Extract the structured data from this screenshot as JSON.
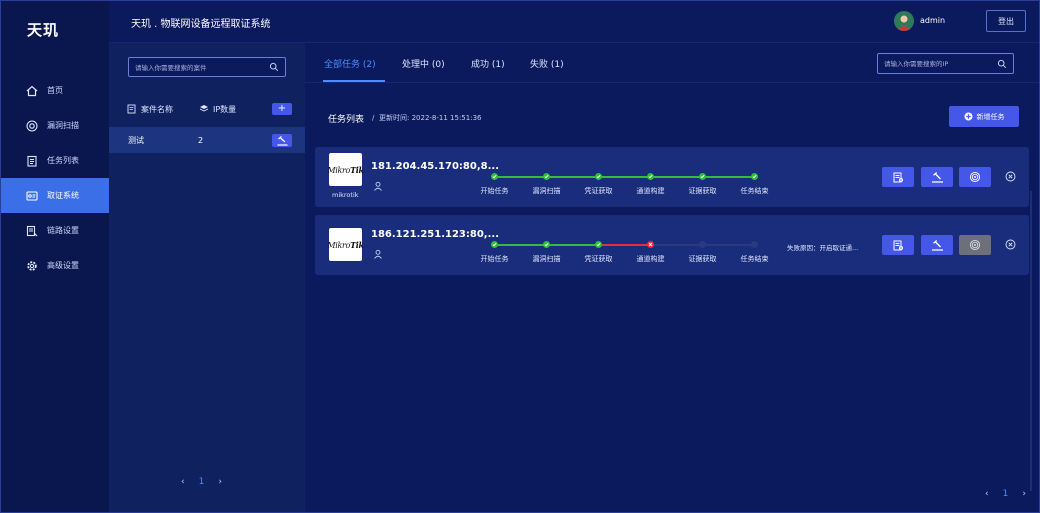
{
  "brand": "天玑",
  "header": {
    "title": "天玑 . 物联网设备远程取证系统",
    "username": "admin",
    "logout": "登出"
  },
  "nav": [
    {
      "label": "首页",
      "icon": "home-icon",
      "active": false
    },
    {
      "label": "漏洞扫描",
      "icon": "scan-icon",
      "active": false
    },
    {
      "label": "任务列表",
      "icon": "clipboard-icon",
      "active": false
    },
    {
      "label": "取证系统",
      "icon": "forensics-icon",
      "active": true
    },
    {
      "label": "链路设置",
      "icon": "link-settings-icon",
      "active": false
    },
    {
      "label": "高级设置",
      "icon": "gear-icon",
      "active": false
    }
  ],
  "case_panel": {
    "search_placeholder": "请输入你需要搜索的案件",
    "col_case_name": "案件名称",
    "col_ip_count": "IP数量",
    "add_label": "+",
    "rows": [
      {
        "name": "测试",
        "count": "2"
      }
    ],
    "pager": {
      "prev": "‹",
      "current": "1",
      "next": "›"
    }
  },
  "main": {
    "tabs": [
      {
        "label": "全部任务 (2)",
        "active": true
      },
      {
        "label": "处理中 (0)",
        "active": false
      },
      {
        "label": "成功 (1)",
        "active": false
      },
      {
        "label": "失败 (1)",
        "active": false
      }
    ],
    "ip_search_placeholder": "请输入你需要搜索的IP",
    "task_list_title": "任务列表",
    "task_list_sep": "/",
    "updated_label": "更新时间:",
    "updated_time": "2022-8-11 15:51:36",
    "new_task_label": "新增任务",
    "pager": {
      "prev": "‹",
      "current": "1",
      "next": "›"
    }
  },
  "step_labels": [
    "开始任务",
    "漏洞扫描",
    "凭证获取",
    "通道构建",
    "证据获取",
    "任务结束"
  ],
  "colors": {
    "success": "#2fbf3b",
    "fail": "#e0313b",
    "pending": "#2a3a7c",
    "accent": "#4457e8"
  },
  "tasks": [
    {
      "ip": "181.204.45.170:80,8...",
      "logo_light": "Mikro",
      "logo_bold": "Tik",
      "logo_caption": "mikrotik",
      "step_states": [
        "done",
        "done",
        "done",
        "done",
        "done",
        "done"
      ],
      "fail_reason": "",
      "third_button_disabled": false
    },
    {
      "ip": "186.121.251.123:80,...",
      "logo_light": "Mikro",
      "logo_bold": "Tik",
      "logo_caption": "",
      "step_states": [
        "done",
        "done",
        "done",
        "fail",
        "pending",
        "pending"
      ],
      "fail_reason": "失败原因：开启取证通...",
      "third_button_disabled": true
    }
  ]
}
